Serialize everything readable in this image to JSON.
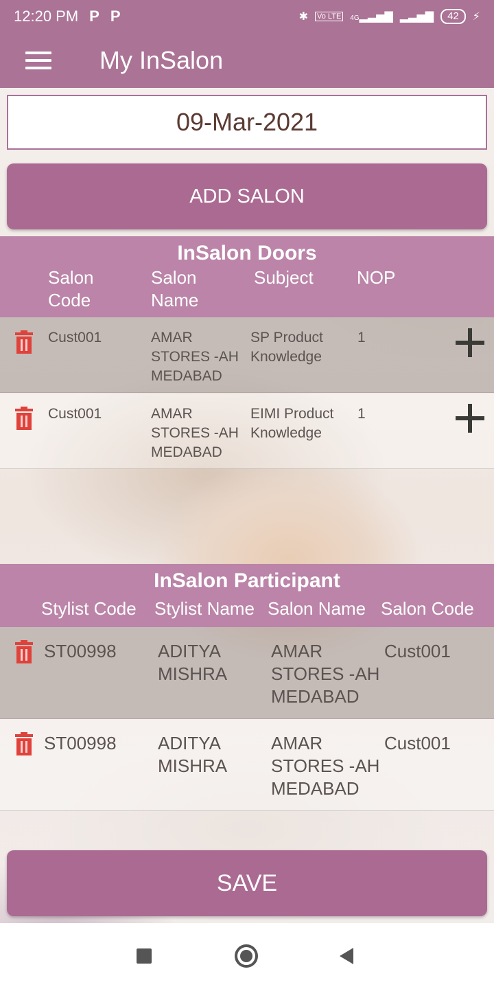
{
  "status_bar": {
    "time": "12:20 PM",
    "notification_icons": [
      "P",
      "P"
    ],
    "network_labels": [
      "Vo LTE",
      "4G"
    ],
    "battery": "42"
  },
  "app_bar": {
    "title": "My InSalon"
  },
  "date_value": "09-Mar-2021",
  "buttons": {
    "add_salon": "ADD SALON",
    "save": "SAVE"
  },
  "doors": {
    "title": "InSalon Doors",
    "columns": [
      "Salon\nCode",
      "Salon\nName",
      "Subject",
      "NOP"
    ],
    "rows": [
      {
        "salon_code": "Cust001",
        "salon_name": "AMAR\nSTORES -AH\nMEDABAD",
        "subject": "SP Product\nKnowledge",
        "nop": "1"
      },
      {
        "salon_code": "Cust001",
        "salon_name": "AMAR\nSTORES -AH\nMEDABAD",
        "subject": "EIMI Product\nKnowledge",
        "nop": "1"
      }
    ]
  },
  "participants": {
    "title": "InSalon Participant",
    "columns": [
      "Stylist Code",
      "Stylist Name",
      "Salon Name",
      "Salon Code"
    ],
    "rows": [
      {
        "stylist_code": "ST00998",
        "stylist_name": "ADITYA\nMISHRA",
        "salon_name": "AMAR\nSTORES -AH\nMEDABAD",
        "salon_code": "Cust001"
      },
      {
        "stylist_code": "ST00998",
        "stylist_name": "ADITYA\nMISHRA",
        "salon_name": "AMAR\nSTORES -AH\nMEDABAD",
        "salon_code": "Cust001"
      }
    ]
  },
  "colors": {
    "primary": "#ab7395",
    "button": "#ab6a92",
    "section_header": "#bb84a8",
    "delete_icon": "#e0413a"
  },
  "icons": [
    "menu-icon",
    "trash-icon",
    "plus-icon",
    "bluetooth-icon",
    "signal-icon",
    "battery-icon",
    "charging-icon"
  ]
}
